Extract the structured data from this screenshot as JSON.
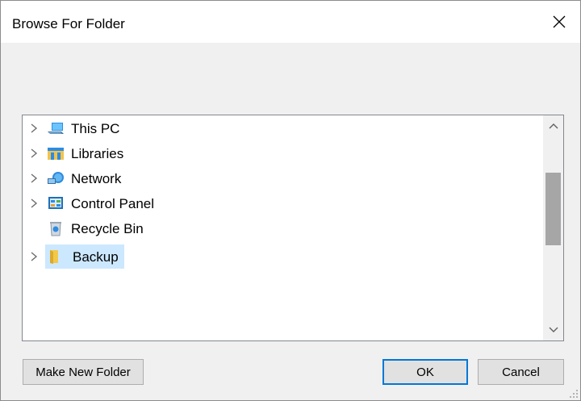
{
  "window": {
    "title": "Browse For Folder"
  },
  "tree": {
    "items": [
      {
        "label": "This PC",
        "icon": "computer-icon",
        "expandable": true
      },
      {
        "label": "Libraries",
        "icon": "libraries-icon",
        "expandable": true
      },
      {
        "label": "Network",
        "icon": "network-icon",
        "expandable": true
      },
      {
        "label": "Control Panel",
        "icon": "control-panel-icon",
        "expandable": true
      },
      {
        "label": "Recycle Bin",
        "icon": "recycle-bin-icon",
        "expandable": false
      },
      {
        "label": "Backup",
        "icon": "folder-icon",
        "expandable": true,
        "selected": true
      }
    ]
  },
  "buttons": {
    "make_new_folder": "Make New Folder",
    "ok": "OK",
    "cancel": "Cancel"
  },
  "colors": {
    "selection": "#cce8ff",
    "default_button_border": "#0078d7",
    "dialog_background": "#f0f0f0"
  }
}
